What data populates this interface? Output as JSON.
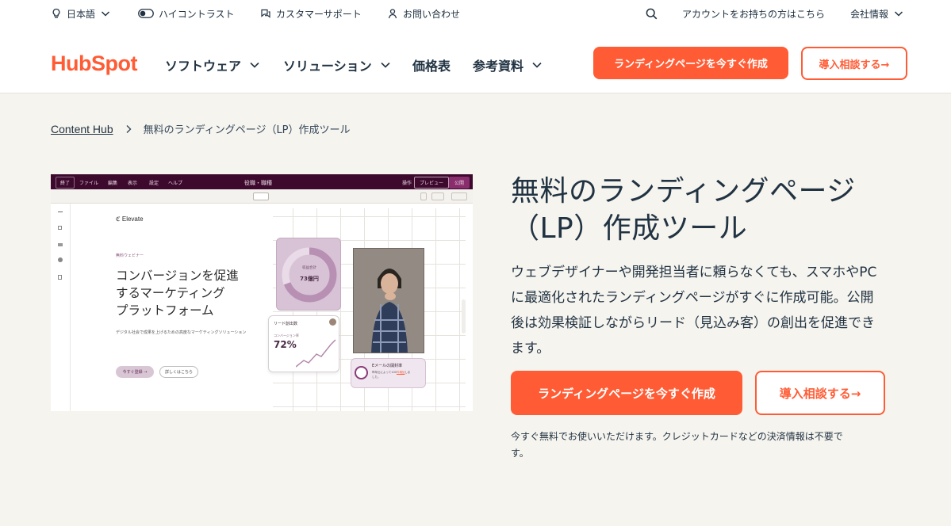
{
  "utility": {
    "language": "日本語",
    "contrast": "ハイコントラスト",
    "support": "カスタマーサポート",
    "contact": "お問い合わせ",
    "account": "アカウントをお持ちの方はこちら",
    "company": "会社情報"
  },
  "nav": {
    "logo": "HubSpot",
    "software": "ソフトウェア",
    "solutions": "ソリューション",
    "pricing": "価格表",
    "resources": "参考資料",
    "cta_primary": "ランディングページを今すぐ作成",
    "cta_secondary": "導入相談する→"
  },
  "breadcrumb": {
    "parent": "Content Hub",
    "current": "無料のランディングページ（LP）作成ツール"
  },
  "editor": {
    "exit": "終了",
    "menus": [
      "ファイル",
      "編集",
      "表示",
      "設定",
      "ヘルプ"
    ],
    "doc_title": "役職・職種",
    "action": "操作",
    "preview": "プレビュー",
    "publish": "公開",
    "brand": "Elevate",
    "eyebrow": "無料ウェビナー",
    "headline_1": "コンバージョンを促進",
    "headline_2": "するマーケティング",
    "headline_3": "プラットフォーム",
    "subtext": "デジタル社会で成果を上げるための高度なマーケティングソリューション",
    "btn_register": "今すぐ登録",
    "btn_details": "詳しくはこちら",
    "revenue_label": "収益合計",
    "revenue_value": "73億円",
    "leads_title": "リード創出数",
    "conversion_label": "コンバージョン率",
    "conversion_value": "72%",
    "email_title": "Eメールの開封率",
    "email_text_1": "昨年比によって100",
    "email_text_link": "件増加",
    "email_text_2": "しま",
    "email_text_3": "した。"
  },
  "hero": {
    "title_line1": "無料のランディングページ",
    "title_line2": "（LP）作成ツール",
    "desc_line1": "ウェブデザイナーや開発担当者に頼らなくても、スマホやPC",
    "desc_line2": "に最適化されたランディングページがすぐに作成可能。公開",
    "desc_line3": "後は効果検証しながらリード（見込み客）の創出を促進でき",
    "desc_line4": "ます。",
    "cta_primary": "ランディングページを今すぐ作成",
    "cta_secondary": "導入相談する→",
    "note_line1": "今すぐ無料でお使いいただけます。クレジットカードなどの決済情報は不要で",
    "note_line2": "す。"
  },
  "colors": {
    "brand": "#ff5c35",
    "text": "#213343",
    "hero_bg": "#f6f4ee",
    "editor_header": "#3d0a2e"
  },
  "icons": [
    "lightbulb-icon",
    "contrast-toggle-icon",
    "chat-icon",
    "person-icon",
    "search-icon",
    "chevron-down-icon",
    "chevron-right-icon"
  ]
}
